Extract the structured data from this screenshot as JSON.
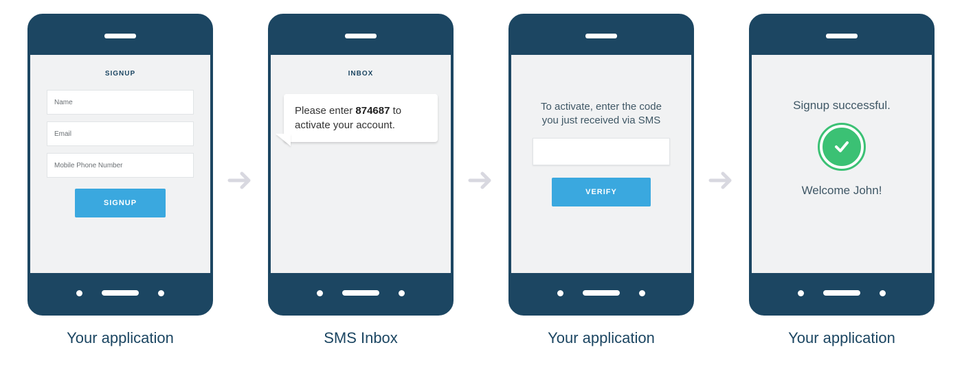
{
  "arrow_color": "#d8d8e0",
  "steps": [
    {
      "caption": "Your application",
      "screen_title": "SIGNUP",
      "fields": {
        "name": "Name",
        "email": "Email",
        "phone": "Mobile Phone Number"
      },
      "signup_button": "SIGNUP"
    },
    {
      "caption": "SMS Inbox",
      "screen_title": "INBOX",
      "sms_prefix": "Please enter ",
      "sms_code": "874687",
      "sms_suffix": " to activate your account."
    },
    {
      "caption": "Your application",
      "instruction": "To activate, enter the code you just received via SMS",
      "verify_button": "VERIFY"
    },
    {
      "caption": "Your application",
      "success_message": "Signup successful.",
      "welcome_message": "Welcome John!"
    }
  ]
}
